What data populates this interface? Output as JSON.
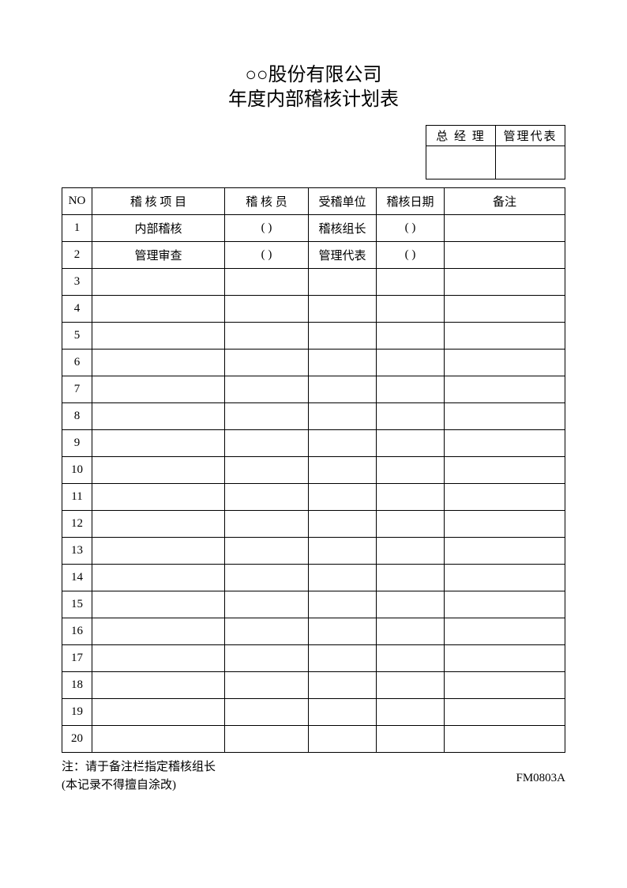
{
  "title": {
    "line1": "○○股份有限公司",
    "line2": "年度内部稽核计划表"
  },
  "approval": {
    "gm_label": "总 经 理",
    "mr_label": "管理代表",
    "gm_value": "",
    "mr_value": ""
  },
  "columns": {
    "no": "NO",
    "item": "稽 核 项 目",
    "auditor": "稽 核 员",
    "unit": "受稽单位",
    "date": "稽核日期",
    "remark": "备注"
  },
  "rows": [
    {
      "no": "1",
      "item": "内部稽核",
      "auditor": "(            )",
      "unit": "稽核组长",
      "date": "(        )",
      "remark": ""
    },
    {
      "no": "2",
      "item": "管理审查",
      "auditor": "(            )",
      "unit": "管理代表",
      "date": "(        )",
      "remark": ""
    },
    {
      "no": "3",
      "item": "",
      "auditor": "",
      "unit": "",
      "date": "",
      "remark": ""
    },
    {
      "no": "4",
      "item": "",
      "auditor": "",
      "unit": "",
      "date": "",
      "remark": ""
    },
    {
      "no": "5",
      "item": "",
      "auditor": "",
      "unit": "",
      "date": "",
      "remark": ""
    },
    {
      "no": "6",
      "item": "",
      "auditor": "",
      "unit": "",
      "date": "",
      "remark": ""
    },
    {
      "no": "7",
      "item": "",
      "auditor": "",
      "unit": "",
      "date": "",
      "remark": ""
    },
    {
      "no": "8",
      "item": "",
      "auditor": "",
      "unit": "",
      "date": "",
      "remark": ""
    },
    {
      "no": "9",
      "item": "",
      "auditor": "",
      "unit": "",
      "date": "",
      "remark": ""
    },
    {
      "no": "10",
      "item": "",
      "auditor": "",
      "unit": "",
      "date": "",
      "remark": ""
    },
    {
      "no": "11",
      "item": "",
      "auditor": "",
      "unit": "",
      "date": "",
      "remark": ""
    },
    {
      "no": "12",
      "item": "",
      "auditor": "",
      "unit": "",
      "date": "",
      "remark": ""
    },
    {
      "no": "13",
      "item": "",
      "auditor": "",
      "unit": "",
      "date": "",
      "remark": ""
    },
    {
      "no": "14",
      "item": "",
      "auditor": "",
      "unit": "",
      "date": "",
      "remark": ""
    },
    {
      "no": "15",
      "item": "",
      "auditor": "",
      "unit": "",
      "date": "",
      "remark": ""
    },
    {
      "no": "16",
      "item": "",
      "auditor": "",
      "unit": "",
      "date": "",
      "remark": ""
    },
    {
      "no": "17",
      "item": "",
      "auditor": "",
      "unit": "",
      "date": "",
      "remark": ""
    },
    {
      "no": "18",
      "item": "",
      "auditor": "",
      "unit": "",
      "date": "",
      "remark": ""
    },
    {
      "no": "19",
      "item": "",
      "auditor": "",
      "unit": "",
      "date": "",
      "remark": ""
    },
    {
      "no": "20",
      "item": "",
      "auditor": "",
      "unit": "",
      "date": "",
      "remark": ""
    }
  ],
  "footer": {
    "note1": "注：请于备注栏指定稽核组长",
    "note2": "(本记录不得擅自涂改)",
    "form_code": "FM0803A"
  }
}
